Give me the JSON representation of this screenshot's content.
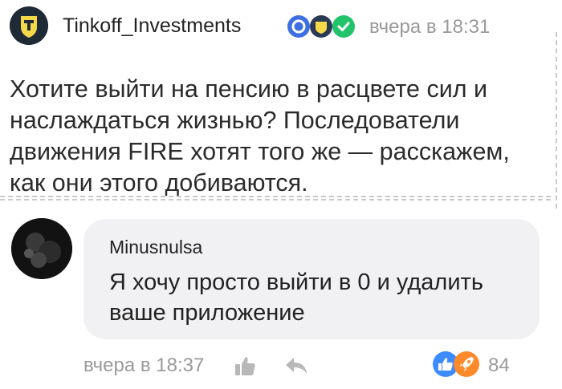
{
  "post": {
    "author": "Tinkoff_Investments",
    "time": "вчера в 18:31",
    "text": "Хотите выйти на пенсию в расцвете сил и наслаждаться жизнью? Последователи движения FIRE хотят того же — расскажем, как они этого добиваются.",
    "badges": [
      "blue-badge-icon",
      "tinkoff-badge-icon",
      "verified-icon"
    ]
  },
  "comment": {
    "author": "Minusnulsa",
    "text": "Я хочу просто выйти в 0 и удалить ваше приложение",
    "time": "вчера в 18:37",
    "reaction_count": "84",
    "reactions": [
      "like-reaction-icon",
      "rocket-reaction-icon"
    ]
  },
  "colors": {
    "bubble": "#f1f1f3",
    "meta_text": "#9a9a9a",
    "like_blue": "#3d8bff",
    "rocket_orange": "#ff8a2a",
    "verified_green": "#21c46b"
  }
}
